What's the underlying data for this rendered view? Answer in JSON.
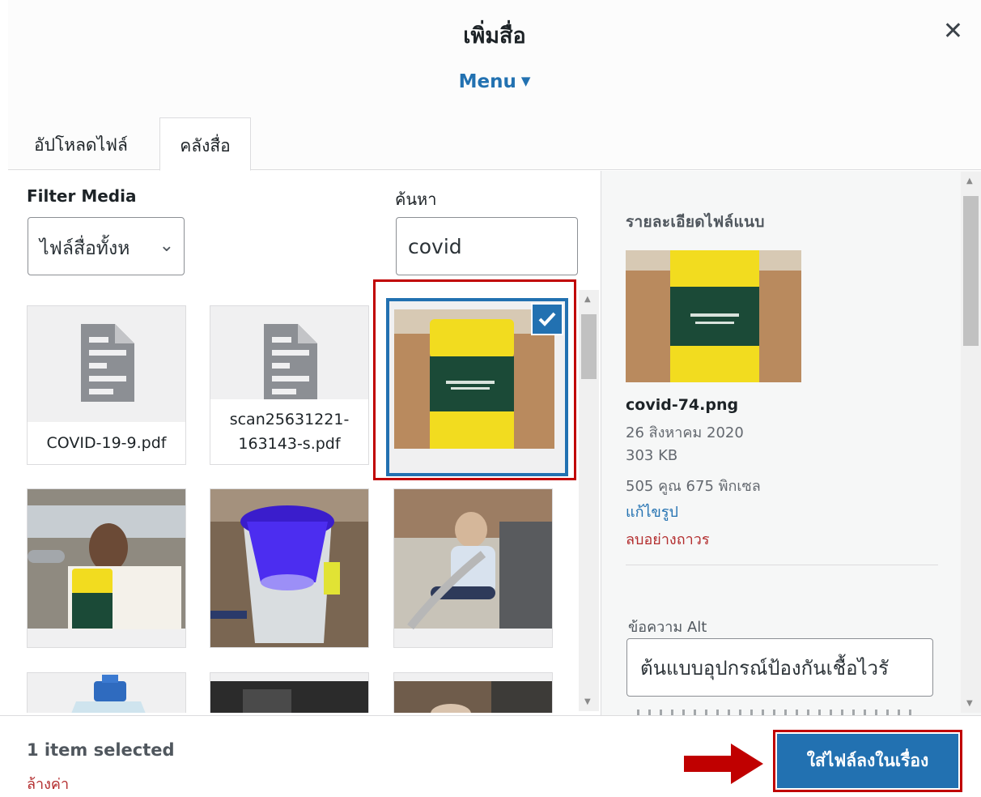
{
  "dialog": {
    "title": "เพิ่มสื่อ",
    "menu_label": "Menu",
    "close_glyph": "✕",
    "tabs": [
      {
        "label": "อัปโหลดไฟล์",
        "active": false
      },
      {
        "label": "คลังสื่อ",
        "active": true
      }
    ]
  },
  "filters": {
    "filter_label": "Filter Media",
    "filter_value": "ไฟล์สื่อทั้งห",
    "search_label": "ค้นหา",
    "search_value": "covid"
  },
  "media_items": [
    {
      "kind": "document",
      "filename": "COVID-19-9.pdf",
      "selected": false
    },
    {
      "kind": "document",
      "filename": "scan25631221-163143-s.pdf",
      "selected": false
    },
    {
      "kind": "image",
      "subject": "yellow-green cylinder",
      "selected": true
    },
    {
      "kind": "image",
      "subject": "person holding device",
      "selected": false
    },
    {
      "kind": "image",
      "subject": "UV light cylinder",
      "selected": false
    },
    {
      "kind": "image",
      "subject": "person seated with hose",
      "selected": false
    }
  ],
  "details": {
    "heading": "รายละเอียดไฟล์แนบ",
    "filename": "covid-74.png",
    "date": "26 สิงหาคม 2020",
    "size": "303 KB",
    "dimensions": "505 คูณ 675 พิกเซล",
    "edit_link": "แก้ไขรูป",
    "delete_link": "ลบอย่างถาวร",
    "alt_label": "ข้อความ Alt",
    "alt_value": "ต้นแบบอุปกรณ์ป้องกันเชื้อไวรั"
  },
  "toolbar": {
    "selected_count": "1 item selected",
    "clear_label": "ล้างค่า",
    "insert_label": "ใส่ไฟล์ลงในเรื่อง"
  },
  "colors": {
    "accent": "#2271b1",
    "highlight_red": "#c00000",
    "danger": "#b32d2e"
  }
}
